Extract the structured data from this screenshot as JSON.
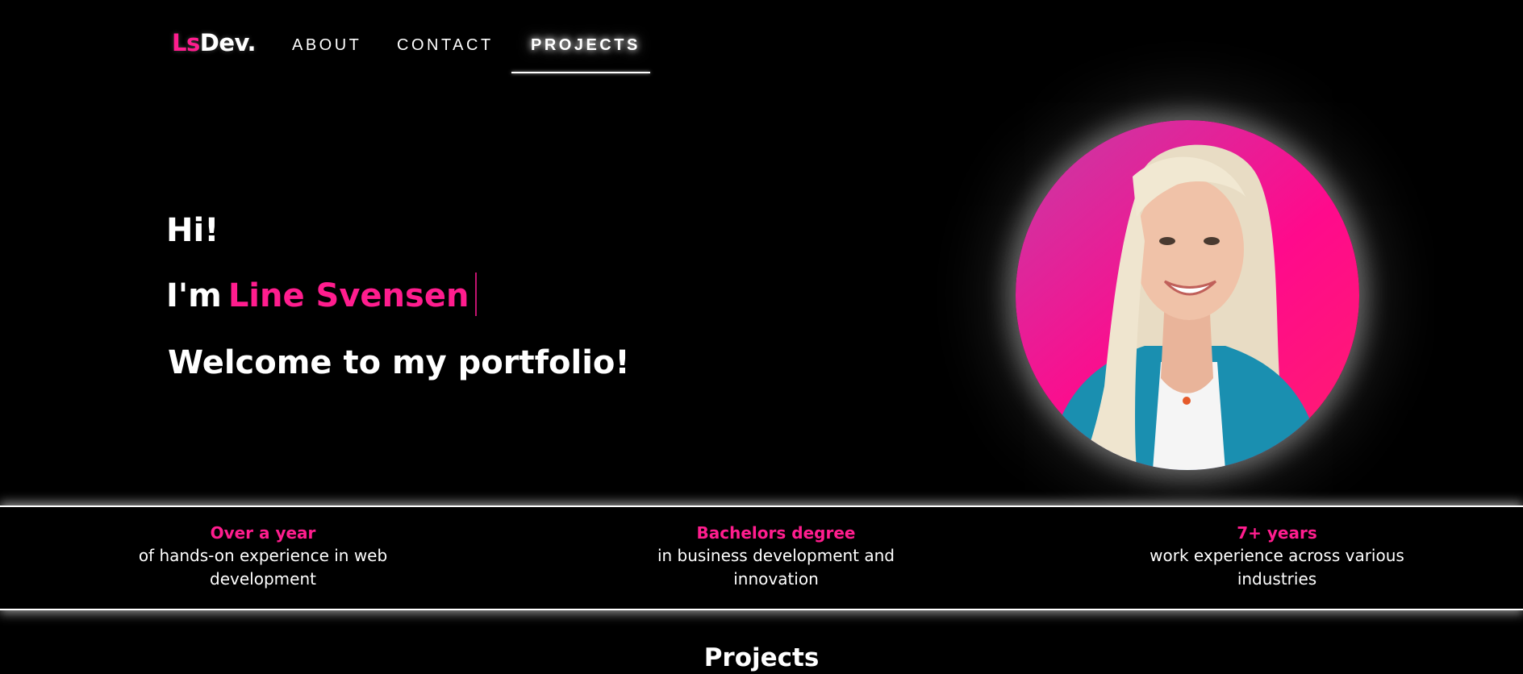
{
  "logo": {
    "part1": "Ls",
    "part2": "Dev."
  },
  "nav": {
    "about": "ABOUT",
    "contact": "CONTACT",
    "projects": "PROJECTS",
    "active": "PROJECTS"
  },
  "hero": {
    "greeting": "Hi!",
    "intro": "I'm",
    "name": "Line Svensen",
    "welcome": "Welcome to my portfolio!"
  },
  "stats": [
    {
      "title": "Over a year",
      "desc": "of hands-on experience in web development"
    },
    {
      "title": "Bachelors degree",
      "desc": "in business development and innovation"
    },
    {
      "title": "7+ years",
      "desc": "work experience across various industries"
    }
  ],
  "projects": {
    "heading": "Projects"
  },
  "colors": {
    "accent": "#ff1d8e",
    "background": "#000000",
    "text": "#ffffff"
  }
}
